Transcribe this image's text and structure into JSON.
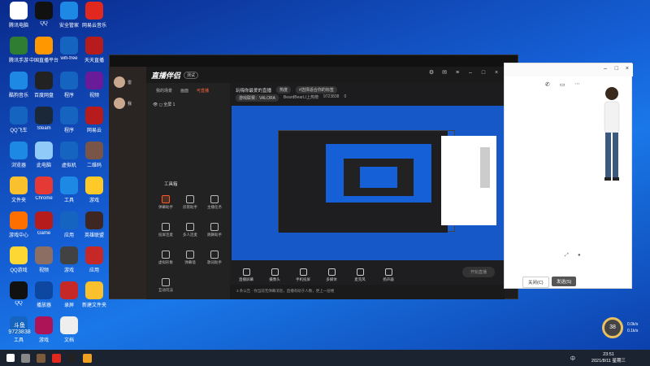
{
  "desktop": {
    "icons": [
      {
        "label": "腾讯电脑",
        "color": "#ffffff"
      },
      {
        "label": "QQ",
        "color": "#111"
      },
      {
        "label": "安全管家",
        "color": "#1e88e5"
      },
      {
        "label": "网易云音乐",
        "color": "#e0281f"
      },
      {
        "label": "腾讯手游",
        "color": "#2e7d32"
      },
      {
        "label": "中国直播平台",
        "color": "#ff9800"
      },
      {
        "label": "wifi-free",
        "color": "#1565c0"
      },
      {
        "label": "天天直播",
        "color": "#b71c1c"
      },
      {
        "label": "酷狗音乐",
        "color": "#1e88e5"
      },
      {
        "label": "百度网盘",
        "color": "#222"
      },
      {
        "label": "程序",
        "color": "#1565c0"
      },
      {
        "label": "视频",
        "color": "#6a1b9a"
      },
      {
        "label": "QQ飞车",
        "color": "#1565c0"
      },
      {
        "label": "Steam",
        "color": "#1b2838"
      },
      {
        "label": "程序",
        "color": "#1565c0"
      },
      {
        "label": "网易云",
        "color": "#b71c1c"
      },
      {
        "label": "浏览器",
        "color": "#1e88e5"
      },
      {
        "label": "此电脑",
        "color": "#90caf9"
      },
      {
        "label": "虚拟机",
        "color": "#1565c0"
      },
      {
        "label": "二维码",
        "color": "#795548"
      },
      {
        "label": "文件夹",
        "color": "#fbc02d"
      },
      {
        "label": "Chrome",
        "color": "#e53935"
      },
      {
        "label": "工具",
        "color": "#1e88e5"
      },
      {
        "label": "游戏",
        "color": "#ffca28"
      },
      {
        "label": "游戏中心",
        "color": "#ff6f00"
      },
      {
        "label": "Game",
        "color": "#b71c1c"
      },
      {
        "label": "应用",
        "color": "#1565c0"
      },
      {
        "label": "英雄联盟",
        "color": "#3e2723"
      },
      {
        "label": "QQ游戏",
        "color": "#fdd835"
      },
      {
        "label": "视频",
        "color": "#8d6e63"
      },
      {
        "label": "游戏",
        "color": "#424242"
      },
      {
        "label": "应用",
        "color": "#c62828"
      },
      {
        "label": "QQ",
        "color": "#111"
      },
      {
        "label": "播放器",
        "color": "#0d47a1"
      },
      {
        "label": "录屏",
        "color": "#c62828"
      },
      {
        "label": "新建文件夹",
        "color": "#fbc02d"
      },
      {
        "label": "工具",
        "color": "#1565c0"
      },
      {
        "label": "游戏",
        "color": "#ad1457"
      },
      {
        "label": "文档",
        "color": "#eeeeee"
      }
    ]
  },
  "app": {
    "logo": "直播伴侣",
    "version": "测试",
    "sidebar_tabs": [
      "我的场景",
      "画面",
      "可直播"
    ],
    "scene_label": "全屏 1",
    "toolbox_title": "工具箱",
    "tools": [
      "弹幕助手",
      "房管助手",
      "主播任务",
      "投屏连麦",
      "多人连麦",
      "跳舞助手",
      "虚拟形象",
      "弹幕墙",
      "歌词助手",
      "互动玩法"
    ],
    "room_title": "玩嗨你最爱的直播",
    "room_tag": "热度",
    "room_tag2": "#选择适合你的标签",
    "room_sub": [
      "游戏联赛：VALORA",
      "BeardBearLI上热榜",
      "9723838",
      "0"
    ],
    "bottom_tools": [
      "直播屏幕",
      "摄像头",
      "手机投屏",
      "多媒体",
      "麦克风",
      "扬声器"
    ],
    "start_label": "开始直播",
    "status": "3 条公告 · 你当前无弹幕消息，直播有助于人数，更上一层楼"
  },
  "left_contacts": [
    "雷",
    "我"
  ],
  "chat": {
    "buttons": [
      "关闭(C)",
      "发送(S)"
    ]
  },
  "overlay": {
    "brand": "斗鱼",
    "room_id": "9723838",
    "badge": "38",
    "net_up": "0.0k/s",
    "net_down": "0.1k/s"
  },
  "taskbar": {
    "tray": "中",
    "time": "23:51",
    "date": "2021/8/11 星期三"
  }
}
